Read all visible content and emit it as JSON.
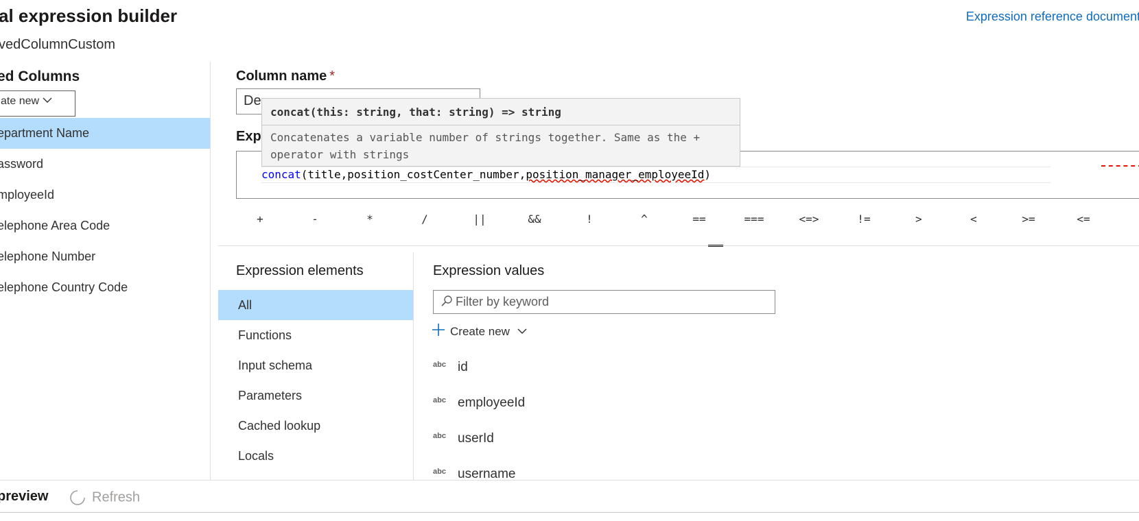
{
  "header": {
    "title": "al expression builder",
    "subtitle": "vedColumnCustom",
    "doc_link": "Expression reference document"
  },
  "left_panel": {
    "heading": "ed Columns",
    "create_new": "ate new",
    "columns": [
      "epartment Name",
      "assword",
      "mployeeId",
      "elephone Area Code",
      "elephone Number",
      "elephone Country Code"
    ],
    "selected_index": 0
  },
  "column_name": {
    "label": "Column name",
    "required_mark": "*",
    "value": "De"
  },
  "expression": {
    "label": "Exp",
    "fn": "concat",
    "args_before": "(title,position_costCenter_number,",
    "args_error": "position_manager_employeeId",
    "args_after": ")"
  },
  "tooltip": {
    "signature": "concat(this: string, that: string) => string",
    "description": "Concatenates a variable number of strings together. Same as the + operator with strings"
  },
  "operators": [
    "+",
    "-",
    "*",
    "/",
    "||",
    "&&",
    "!",
    "^",
    "==",
    "===",
    "<=>",
    "!=",
    ">",
    "<",
    ">=",
    "<="
  ],
  "active_operator": "==",
  "expression_elements": {
    "heading": "Expression elements",
    "items": [
      "All",
      "Functions",
      "Input schema",
      "Parameters",
      "Cached lookup",
      "Locals"
    ],
    "selected": "All"
  },
  "expression_values": {
    "heading": "Expression values",
    "filter_placeholder": "Filter by keyword",
    "create_new": "Create new",
    "type_badge": "abc",
    "values": [
      "id",
      "employeeId",
      "userId",
      "username"
    ]
  },
  "footer": {
    "preview": "preview",
    "refresh": "Refresh"
  },
  "colors": {
    "accent": "#0f6cbd",
    "selection": "#b4dcfc",
    "error": "#e51400"
  }
}
